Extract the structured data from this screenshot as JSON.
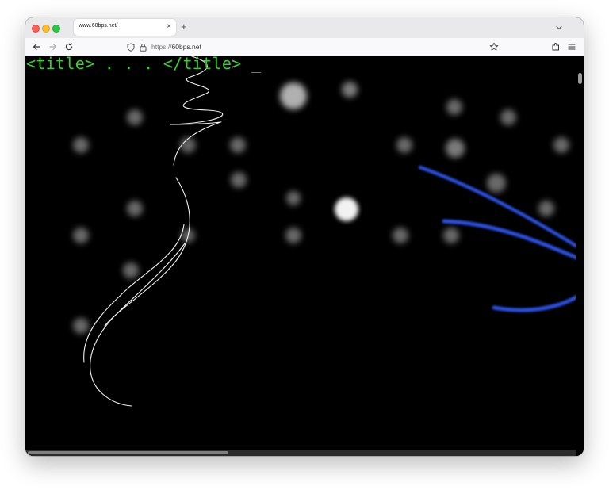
{
  "browser": {
    "tab_title": "www.60bps.net/",
    "url_scheme": "https://",
    "url_host": "60bps.net"
  },
  "page": {
    "heading": "<title> . . . </title> _",
    "text_color": "#35d02a",
    "background_color": "#000000",
    "accent_strokes_color": "#2a4fe0"
  },
  "icons": [
    "close-icon",
    "plus-icon",
    "chevron-down-icon",
    "back-arrow-icon",
    "forward-arrow-icon",
    "reload-icon",
    "shield-icon",
    "lock-icon",
    "star-icon",
    "extensions-icon",
    "menu-icon"
  ]
}
